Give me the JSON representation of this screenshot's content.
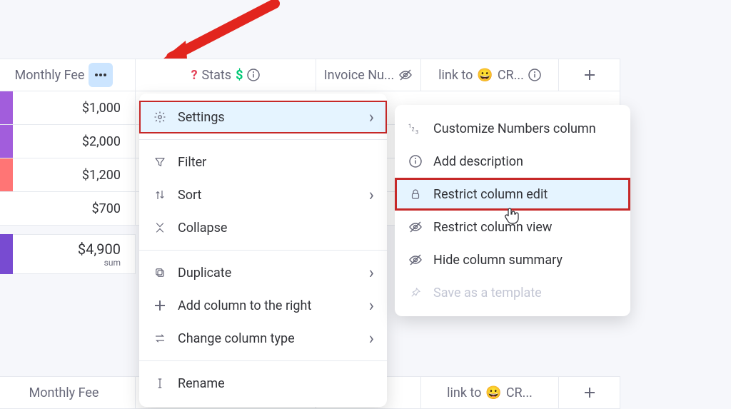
{
  "columns": {
    "monthly": "Monthly Fee",
    "stats": "Stats",
    "invoice": "Invoice Nu...",
    "link": "link to",
    "link_target": "CR..."
  },
  "rows": [
    {
      "color": "purple",
      "value": "$1,000"
    },
    {
      "color": "purple",
      "value": "$2,000"
    },
    {
      "color": "orange",
      "value": "$1,200"
    },
    {
      "color": "none",
      "value": "$700"
    }
  ],
  "footer": {
    "value": "$4,900",
    "label": "sum"
  },
  "second_header_monthly": "Monthly Fee",
  "column_menu": {
    "settings": "Settings",
    "filter": "Filter",
    "sort": "Sort",
    "collapse": "Collapse",
    "duplicate": "Duplicate",
    "add_right": "Add column to the right",
    "change_type": "Change column type",
    "rename": "Rename"
  },
  "settings_submenu": {
    "customize": "Customize Numbers column",
    "add_desc": "Add description",
    "restrict_edit": "Restrict column edit",
    "restrict_view": "Restrict column view",
    "hide_summary": "Hide column summary",
    "save_template": "Save as a template"
  }
}
